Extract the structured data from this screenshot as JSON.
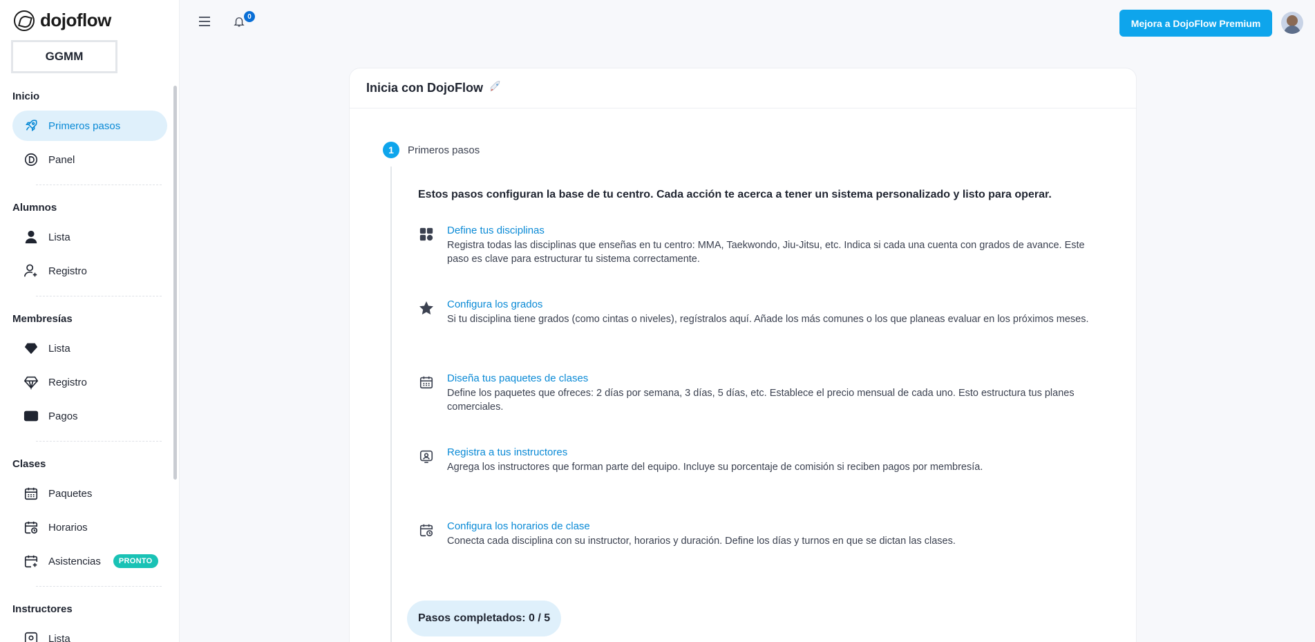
{
  "app": {
    "logo_text": "dojoflow",
    "org_name": "GGMM"
  },
  "sidebar": {
    "sections": [
      {
        "title": "Inicio",
        "items": [
          {
            "label": "Primeros pasos",
            "icon": "rocket-icon",
            "active": true
          },
          {
            "label": "Panel",
            "icon": "dojo-coin-icon"
          }
        ]
      },
      {
        "title": "Alumnos",
        "items": [
          {
            "label": "Lista",
            "icon": "user-icon"
          },
          {
            "label": "Registro",
            "icon": "user-plus-icon"
          }
        ]
      },
      {
        "title": "Membresías",
        "items": [
          {
            "label": "Lista",
            "icon": "diamond-icon"
          },
          {
            "label": "Registro",
            "icon": "diamond-outline-icon"
          },
          {
            "label": "Pagos",
            "icon": "card-icon"
          }
        ]
      },
      {
        "title": "Clases",
        "items": [
          {
            "label": "Paquetes",
            "icon": "calendar-grid-icon"
          },
          {
            "label": "Horarios",
            "icon": "calendar-clock-icon"
          },
          {
            "label": "Asistencias",
            "icon": "calendar-plus-icon",
            "badge": "PRONTO"
          }
        ]
      },
      {
        "title": "Instructores",
        "items": [
          {
            "label": "Lista",
            "icon": "instructor-icon"
          }
        ]
      }
    ]
  },
  "topbar": {
    "menu_icon": "hamburger-icon",
    "bell_icon": "bell-icon",
    "notification_count": "0",
    "premium_prefix": "Mejora a DojoFlow",
    "premium_bold": "Premium"
  },
  "card": {
    "title": "Inicia con DojoFlow",
    "step_number": "1",
    "step_label": "Primeros pasos",
    "intro": "Estos pasos configuran la base de tu centro. Cada acción te acerca a tener un sistema personalizado y listo para operar.",
    "tasks": [
      {
        "title": "Define tus disciplinas",
        "icon": "grid-apps-icon",
        "desc": "Registra todas las disciplinas que enseñas en tu centro: MMA, Taekwondo, Jiu-Jitsu, etc. Indica si cada una cuenta con grados de avance. Este paso es clave para estructurar tu sistema correctamente."
      },
      {
        "title": "Configura los grados",
        "icon": "star-icon",
        "desc": "Si tu disciplina tiene grados (como cintas o niveles), regístralos aquí. Añade los más comunes o los que planeas evaluar en los próximos meses."
      },
      {
        "title": "Diseña tus paquetes de clases",
        "icon": "calendar-grid-icon",
        "desc": "Define los paquetes que ofreces: 2 días por semana, 3 días, 5 días, etc. Establece el precio mensual de cada uno. Esto estructura tus planes comerciales."
      },
      {
        "title": "Registra a tus instructores",
        "icon": "instructor-icon",
        "desc": "Agrega los instructores que forman parte del equipo. Incluye su porcentaje de comisión si reciben pagos por membresía."
      },
      {
        "title": "Configura los horarios de clase",
        "icon": "calendar-clock-icon",
        "desc": "Conecta cada disciplina con su instructor, horarios y duración. Define los días y turnos en que se dictan las clases."
      }
    ],
    "progress_label": "Pasos completados: 0 / 5"
  },
  "colors": {
    "accent": "#0ea5ec",
    "link": "#0a8ad6",
    "active_bg": "#dff0fb",
    "badge": "#19c2b5"
  }
}
